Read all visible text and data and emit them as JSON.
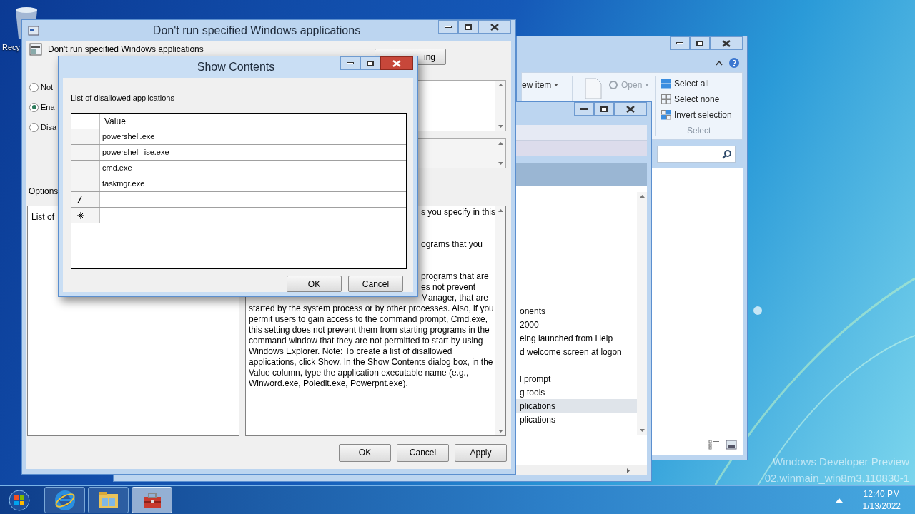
{
  "desktop": {
    "recycle_bin_label": "Recy",
    "watermark": [
      "Windows Developer Preview",
      "02.winmain_win8m3.110830-1"
    ]
  },
  "explorer": {
    "ribbon": [
      {
        "label": "ew item",
        "disabled": false
      },
      {
        "label": "Open",
        "disabled": true
      }
    ],
    "select_items": [
      "Select all",
      "Select none",
      "Invert selection"
    ],
    "select_group_label": "Select"
  },
  "policy_editor": {
    "items": [
      {
        "label": "onents",
        "selected": false,
        "kind": "row"
      },
      {
        "label": "2000",
        "selected": false,
        "kind": "row"
      },
      {
        "label": "eing launched from Help",
        "selected": false,
        "kind": "row"
      },
      {
        "label": "d welcome screen at logon",
        "selected": false,
        "kind": "row"
      },
      {
        "label": "l prompt",
        "selected": false,
        "kind": "gaprow"
      },
      {
        "label": "g tools",
        "selected": false,
        "kind": "row"
      },
      {
        "label": "plications",
        "selected": true,
        "kind": "row"
      },
      {
        "label": "plications",
        "selected": false,
        "kind": "row"
      }
    ]
  },
  "setting_dialog": {
    "title": "Don't run specified Windows applications",
    "heading": "Don't run specified Windows applications",
    "next_button": "ing",
    "options": [
      {
        "label": "Not",
        "selected": false
      },
      {
        "label": "Ena",
        "selected": true
      },
      {
        "label": "Disa",
        "selected": false
      }
    ],
    "options_label": "Options",
    "options_panel_text": "List of",
    "help_lines": [
      {
        "kind": "fragment",
        "text": "s you specify in this"
      },
      {
        "kind": "gapfragment",
        "text": "ograms that you"
      },
      {
        "kind": "gapfragment",
        "text": "programs that are"
      },
      {
        "kind": "fragment",
        "text": "es not prevent"
      },
      {
        "kind": "fragment",
        "text": "Manager, that are"
      },
      {
        "kind": "full",
        "text": "started by the system process or by other processes. Also, if you"
      },
      {
        "kind": "full",
        "text": "permit users to gain access to the command prompt, Cmd.exe,"
      },
      {
        "kind": "full",
        "text": "this setting does not prevent them from starting programs in the"
      },
      {
        "kind": "full",
        "text": "command window that they are not permitted to start by using"
      },
      {
        "kind": "full",
        "text": "Windows Explorer. Note: To create a list of disallowed"
      },
      {
        "kind": "full",
        "text": "applications, click Show. In the Show Contents dialog box, in the"
      },
      {
        "kind": "full",
        "text": "Value column, type the application executable name (e.g.,"
      },
      {
        "kind": "full",
        "text": "Winword.exe, Poledit.exe, Powerpnt.exe)."
      }
    ],
    "buttons": [
      "OK",
      "Cancel",
      "Apply"
    ]
  },
  "show_contents": {
    "title": "Show Contents",
    "label": "List of disallowed applications",
    "column": "Value",
    "rows": [
      {
        "kind": "value",
        "value": "powershell.exe"
      },
      {
        "kind": "value",
        "value": "powershell_ise.exe"
      },
      {
        "kind": "value",
        "value": "cmd.exe"
      },
      {
        "kind": "value",
        "value": "taskmgr.exe"
      },
      {
        "kind": "editing"
      },
      {
        "kind": "new"
      }
    ],
    "buttons": [
      "OK",
      "Cancel"
    ]
  },
  "taskbar": {
    "apps": [
      {
        "kind": "ie",
        "selected": false
      },
      {
        "kind": "explorer",
        "selected": false
      },
      {
        "kind": "toolbox",
        "selected": true
      }
    ],
    "time": "12:40 PM",
    "date": "1/13/2022"
  }
}
